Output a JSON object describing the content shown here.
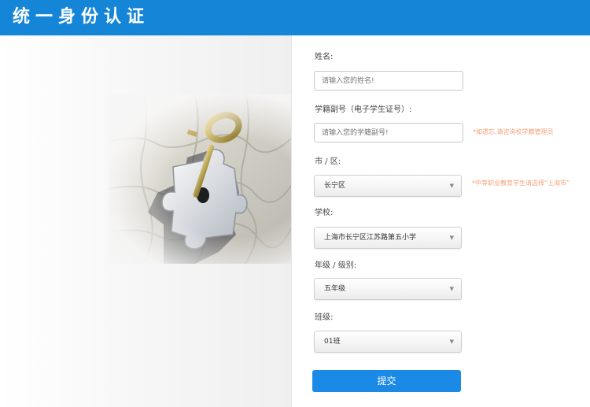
{
  "header": {
    "title": "统一身份认证"
  },
  "illustration": {
    "icon": "puzzle-key-icon"
  },
  "form": {
    "name": {
      "label": "姓名:",
      "placeholder": "请输入您的姓名!"
    },
    "student_no": {
      "label": "学籍副号（电子学生证号）:",
      "placeholder": "请输入您的学籍副号!",
      "hint": "*如遗忘,请咨询校学籍管理员"
    },
    "district": {
      "label": "市 / 区:",
      "value": "长宁区",
      "hint": "*中等职业教育学生请选择“上海市”"
    },
    "school": {
      "label": "学校:",
      "value": "上海市长宁区江苏路第五小学"
    },
    "grade": {
      "label": "年级 / 级别:",
      "value": "五年级"
    },
    "class": {
      "label": "班级:",
      "value": "01班"
    },
    "submit_label": "提交"
  },
  "colors": {
    "header": "#1585d8",
    "button": "#1b8ae6",
    "hint": "#f3a27a"
  }
}
